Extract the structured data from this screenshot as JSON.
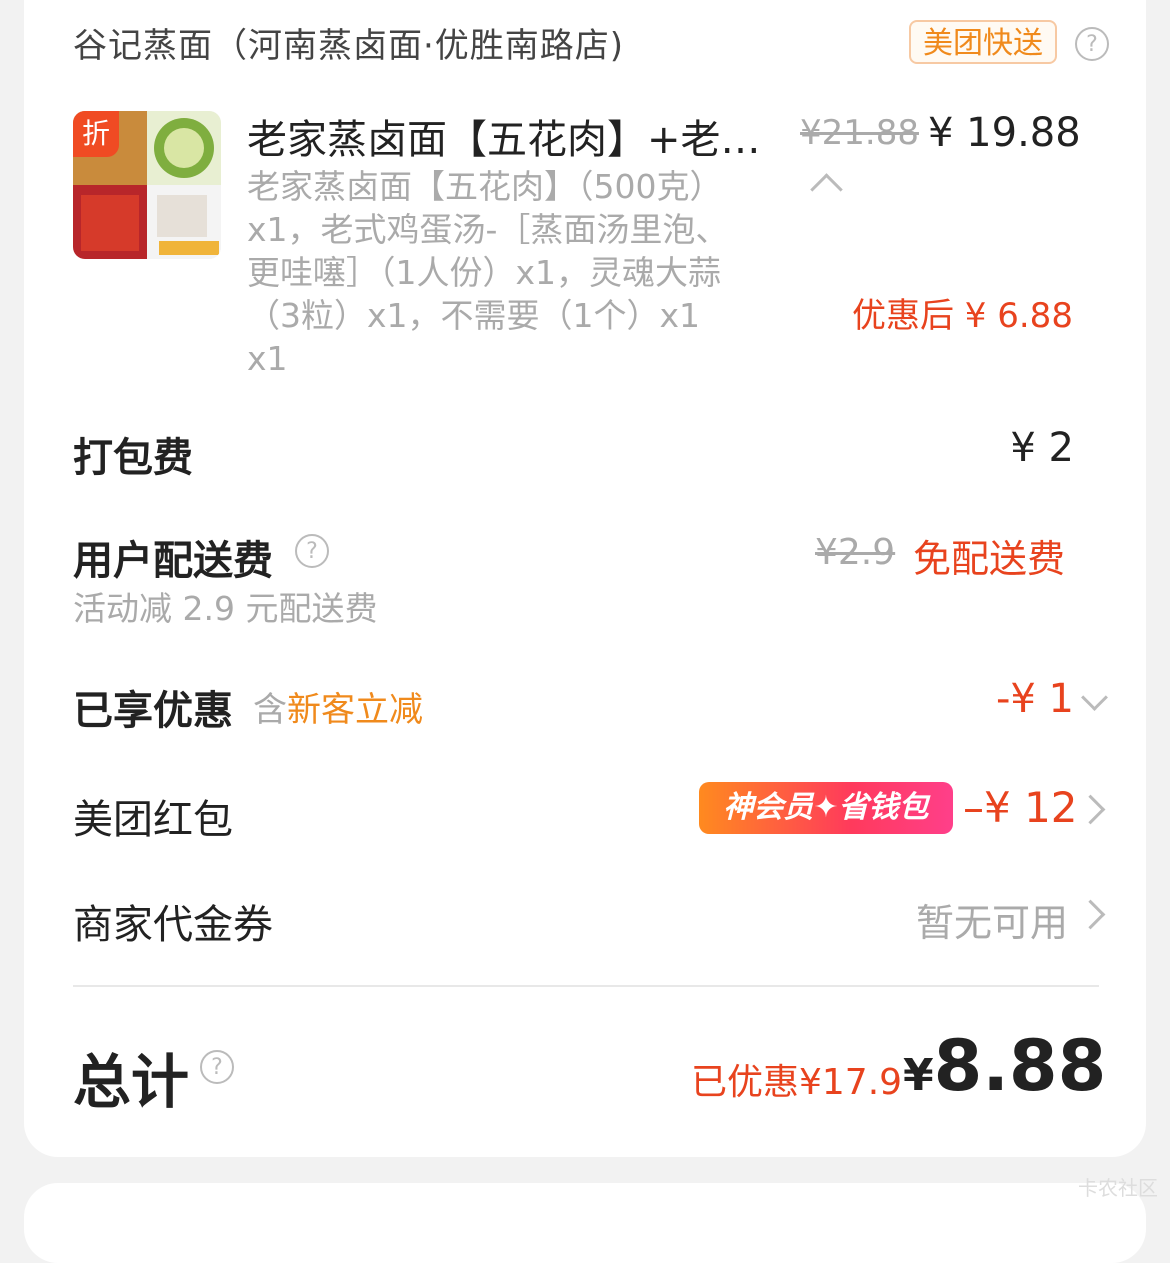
{
  "store": {
    "name": "谷记蒸面（河南蒸卤面·优胜南路店)",
    "delivery_badge": "美团快送",
    "help_icon": "question-circle-icon"
  },
  "item": {
    "tag": "折",
    "title": "老家蒸卤面【五花肉】+老…",
    "original_price": "¥21.88",
    "price": "¥ 19.88",
    "desc_lines": [
      "老家蒸卤面【五花肉】（500克）",
      "x1，老式鸡蛋汤-［蒸面汤里泡、",
      "更哇噻］（1人份）x1，灵魂大蒜",
      "（3粒）x1，不需要（1个）x1",
      "x1"
    ],
    "after_discount": "优惠后 ¥ 6.88"
  },
  "rows": {
    "packing": {
      "label": "打包费",
      "value": "¥ 2"
    },
    "delivery": {
      "label": "用户配送费",
      "original": "¥2.9",
      "value": "免配送费",
      "note": "活动减 2.9 元配送费"
    },
    "discount": {
      "label": "已享优惠",
      "contains": "含",
      "promo": "新客立减",
      "value": "-¥ 1"
    },
    "redpacket": {
      "label": "美团红包",
      "badge": "神会员✦省钱包",
      "value": "–¥ 12"
    },
    "voucher": {
      "label": "商家代金券",
      "value": "暂无可用"
    }
  },
  "total": {
    "label": "总计",
    "discounted": "已优惠¥17.9",
    "currency": "¥",
    "amount": "8.88"
  },
  "watermark": "卡农社区",
  "colors": {
    "accent_red": "#e8431e",
    "accent_orange": "#f08a1c",
    "muted_gray": "#aaaaaa"
  }
}
